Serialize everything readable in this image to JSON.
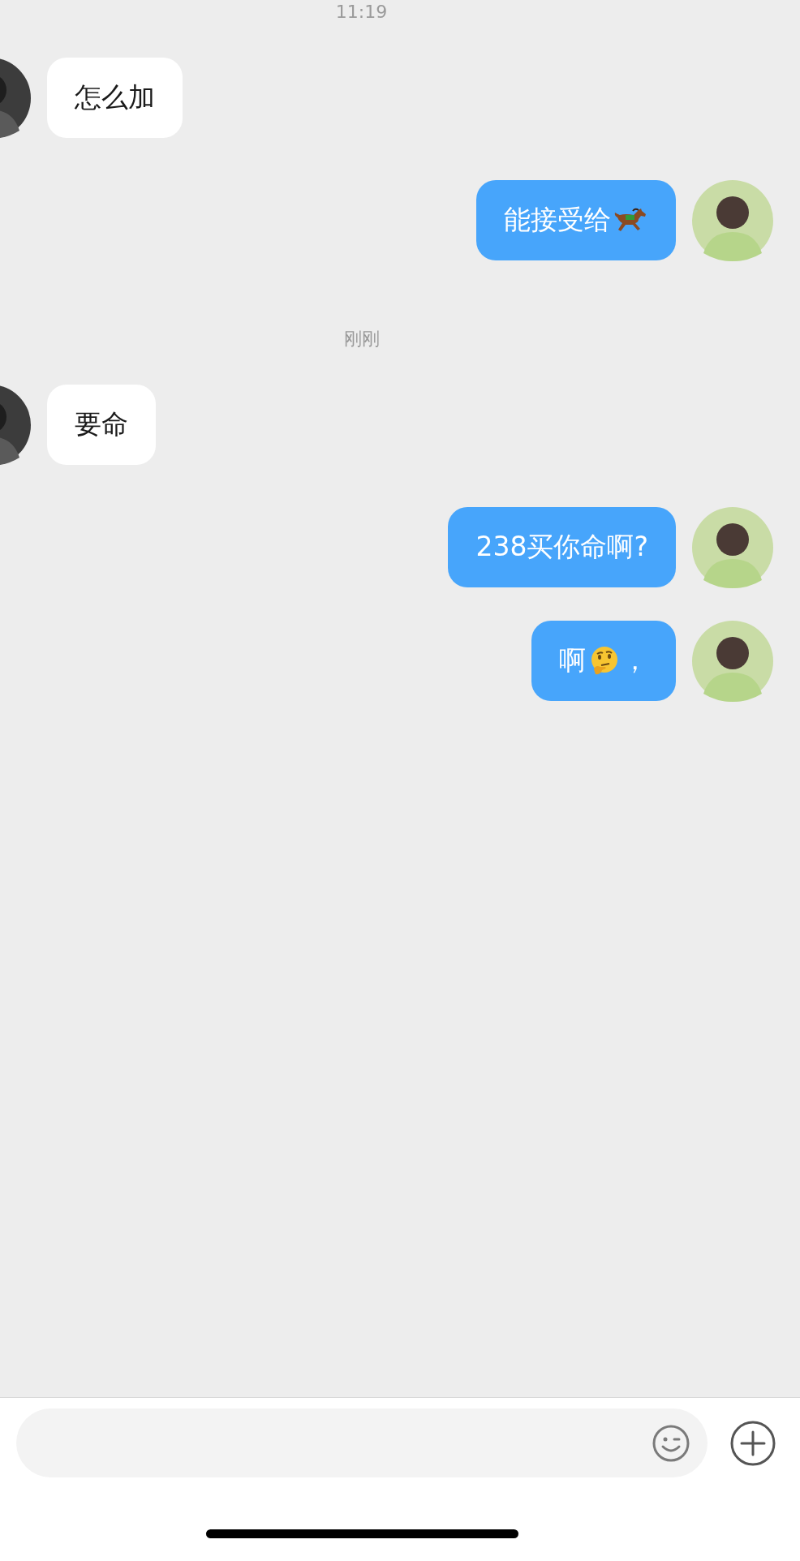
{
  "messages": [
    {
      "kind": "time",
      "text": "11:19"
    },
    {
      "kind": "incoming",
      "segments": [
        {
          "kind": "text",
          "text": "怎么加"
        }
      ]
    },
    {
      "kind": "outgoing",
      "segments": [
        {
          "kind": "text",
          "text": "能接受给"
        },
        {
          "kind": "horse"
        }
      ]
    },
    {
      "kind": "time",
      "text": "刚刚"
    },
    {
      "kind": "incoming",
      "segments": [
        {
          "kind": "text",
          "text": "要命"
        }
      ]
    },
    {
      "kind": "outgoing",
      "segments": [
        {
          "kind": "text",
          "text": "238买你命啊?"
        }
      ]
    },
    {
      "kind": "outgoing",
      "segments": [
        {
          "kind": "text",
          "text": "啊"
        },
        {
          "kind": "thinking"
        },
        {
          "kind": "text",
          "text": "，"
        }
      ]
    }
  ]
}
